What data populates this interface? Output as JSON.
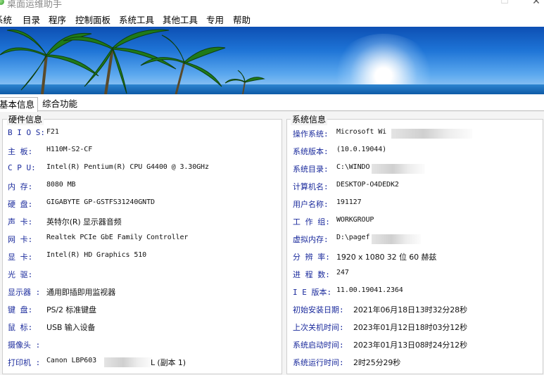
{
  "window": {
    "title": "桌面运维助手",
    "minimize_glyph": "—",
    "maximize_glyph": "☐",
    "close_glyph": "✕"
  },
  "menu": [
    "系统",
    "目录",
    "程序",
    "控制面板",
    "系统工具",
    "其他工具",
    "专用",
    "帮助"
  ],
  "tabs": [
    "基本信息",
    "综合功能"
  ],
  "hardware": {
    "title": "硬件信息",
    "rows": [
      {
        "label": "B I O S:",
        "value": "F21"
      },
      {
        "label": "主   板:",
        "value": "H110M-S2-CF"
      },
      {
        "label": "C  P  U:",
        "value": "Intel(R) Pentium(R) CPU G4400 @ 3.30GHz"
      },
      {
        "label": "内   存:",
        "value": "8080 MB"
      },
      {
        "label": "硬   盘:",
        "value": "GIGABYTE GP-GSTFS31240GNTD"
      },
      {
        "label": "声   卡:",
        "value": "英特尔(R) 显示器音频"
      },
      {
        "label": "网   卡:",
        "value": "Realtek PCIe GbE Family Controller"
      },
      {
        "label": "显   卡:",
        "value": "Intel(R) HD Graphics 510"
      },
      {
        "label": "光   驱:",
        "value": ""
      },
      {
        "label": "显示器 :",
        "value": "通用即插即用监视器"
      },
      {
        "label": "键   盘:",
        "value": "PS/2 标准键盘"
      },
      {
        "label": "鼠   标:",
        "value": "USB 输入设备"
      },
      {
        "label": "摄像头 :",
        "value": ""
      },
      {
        "label": "打印机 :",
        "value": "Canon LBP603",
        "value_tail": "L (副本 1)"
      }
    ]
  },
  "system": {
    "title": "系统信息",
    "rows": [
      {
        "label": "操作系统:",
        "value": "Microsoft Wi"
      },
      {
        "label": "系统版本:",
        "value": " (10.0.19044)"
      },
      {
        "label": "系统目录:",
        "value": "C:\\WINDO"
      },
      {
        "label": "计算机名:",
        "value": "DESKTOP-O4DEDK2"
      },
      {
        "label": "用户名称:",
        "value": "191127"
      },
      {
        "label": "工 作 组:",
        "value": "WORKGROUP"
      },
      {
        "label": "虚拟内存:",
        "value": "D:\\pagef"
      },
      {
        "label": "分 辨 率:",
        "value": "1920 x 1080 32 位 60 赫兹"
      },
      {
        "label": "进 程 数:",
        "value": "247"
      },
      {
        "label": "I E 版本:",
        "value": "11.00.19041.2364"
      },
      {
        "label": "初始安装日期:",
        "value": "2021年06月18日13时32分28秒"
      },
      {
        "label": "上次关机时间:",
        "value": "2023年01月12日18时03分12秒"
      },
      {
        "label": "系统启动时间:",
        "value": "2023年01月13日08时24分12秒"
      },
      {
        "label": "系统运行时间:",
        "value": "2时25分29秒"
      }
    ]
  }
}
